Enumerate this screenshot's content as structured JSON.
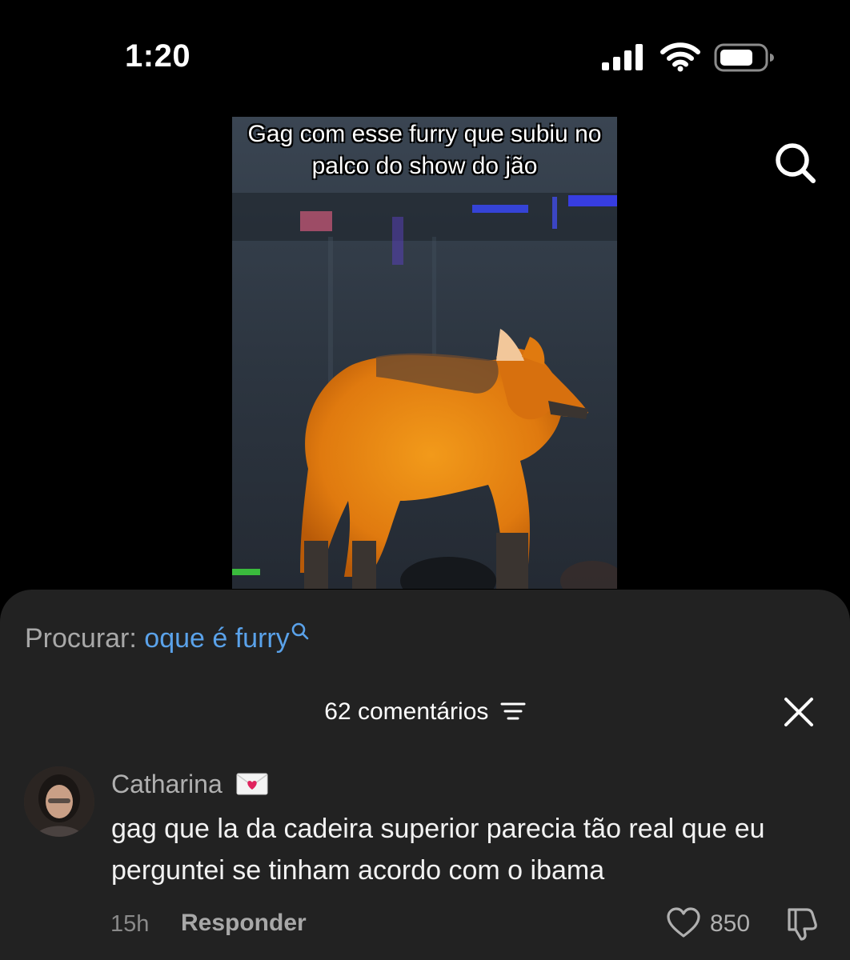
{
  "status_bar": {
    "time": "1:20",
    "icons": [
      "cellular-signal-icon",
      "wifi-icon",
      "battery-icon"
    ]
  },
  "video": {
    "caption": "Gag com esse furry que subiu no palco do show do jão"
  },
  "search": {
    "label": "Procurar:",
    "query": "oque é furry"
  },
  "comments": {
    "count_label": "62 comentários",
    "items": [
      {
        "author": "Catharina",
        "badge": "love-letter-emoji",
        "text": "gag que la da cadeira superior parecia tão real que eu perguntei se tinham acordo com o ibama",
        "time": "15h",
        "reply_label": "Responder",
        "likes": "850"
      }
    ]
  },
  "colors": {
    "background": "#000000",
    "sheet": "#222222",
    "link": "#5aa2ea",
    "muted": "#a8a8a8"
  }
}
